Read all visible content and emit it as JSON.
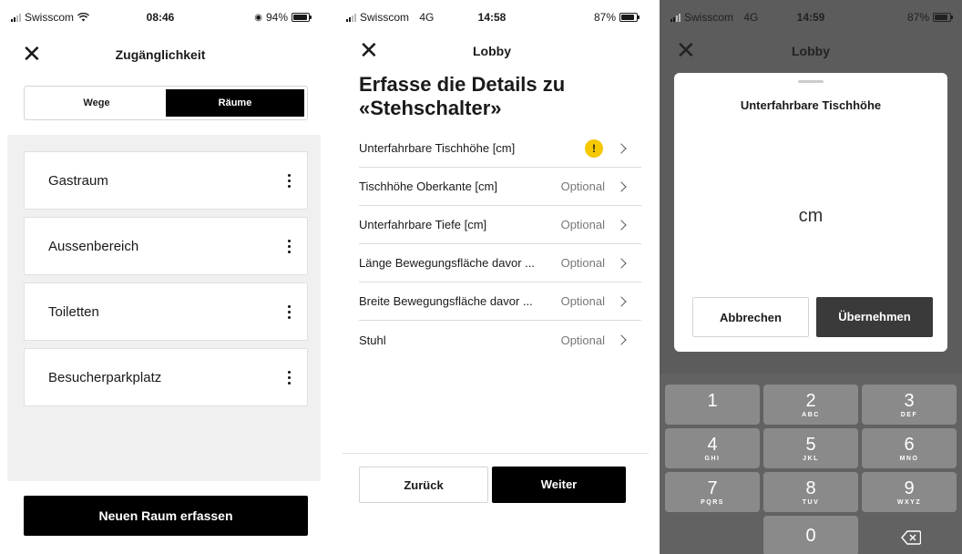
{
  "screen1": {
    "status": {
      "carrier": "Swisscom",
      "time": "08:46",
      "battery": "94%",
      "battery_level": 0.94
    },
    "nav": {
      "title": "Zugänglichkeit"
    },
    "segments": [
      "Wege",
      "Räume"
    ],
    "rooms": [
      "Gastraum",
      "Aussenbereich",
      "Toiletten",
      "Besucherparkplatz"
    ],
    "add_button": "Neuen Raum erfassen"
  },
  "screen2": {
    "status": {
      "carrier": "Swisscom",
      "network": "4G",
      "time": "14:58",
      "battery": "87%",
      "battery_level": 0.87
    },
    "nav": {
      "title": "Lobby"
    },
    "heading_line1": "Erfasse die Details zu",
    "heading_line2": "«Stehschalter»",
    "fields": [
      {
        "label": "Unterfahrbare Tischhöhe [cm]",
        "status": "!"
      },
      {
        "label": "Tischhöhe Oberkante [cm]",
        "status": "Optional"
      },
      {
        "label": "Unterfahrbare Tiefe [cm]",
        "status": "Optional"
      },
      {
        "label": "Länge Bewegungsfläche davor ...",
        "status": "Optional"
      },
      {
        "label": "Breite Bewegungsfläche davor ...",
        "status": "Optional"
      },
      {
        "label": "Stuhl",
        "status": "Optional"
      }
    ],
    "back_button": "Zurück",
    "next_button": "Weiter"
  },
  "screen3": {
    "status": {
      "carrier": "Swisscom",
      "network": "4G",
      "time": "14:59",
      "battery": "87%",
      "battery_level": 0.87
    },
    "nav": {
      "title": "Lobby"
    },
    "modal": {
      "title": "Unterfahrbare Tischhöhe",
      "unit": "cm",
      "cancel": "Abbrechen",
      "apply": "Übernehmen"
    },
    "keys": [
      {
        "digit": "1",
        "letters": ""
      },
      {
        "digit": "2",
        "letters": "ABC"
      },
      {
        "digit": "3",
        "letters": "DEF"
      },
      {
        "digit": "4",
        "letters": "GHI"
      },
      {
        "digit": "5",
        "letters": "JKL"
      },
      {
        "digit": "6",
        "letters": "MNO"
      },
      {
        "digit": "7",
        "letters": "PQRS"
      },
      {
        "digit": "8",
        "letters": "TUV"
      },
      {
        "digit": "9",
        "letters": "WXYZ"
      },
      {
        "digit": "0",
        "letters": ""
      }
    ]
  },
  "colors": {
    "primary": "#000000",
    "warning": "#f5c800",
    "list_bg": "#f0f0f0",
    "keypad_bg": "#626262",
    "key_bg": "#8a8a8a"
  },
  "icons": [
    "signal-icon",
    "wifi-icon",
    "battery-icon",
    "close-icon",
    "more-vertical-icon",
    "warning-icon",
    "chevron-right-icon",
    "backspace-icon"
  ]
}
